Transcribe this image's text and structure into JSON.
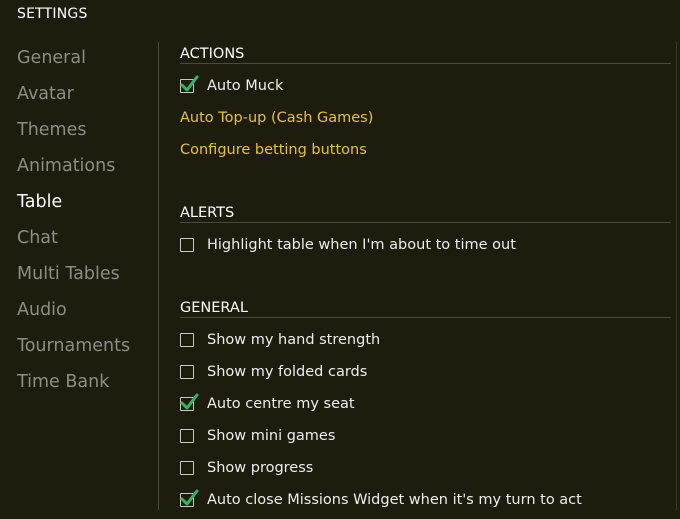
{
  "title": "SETTINGS",
  "sidebar": {
    "items": [
      {
        "label": "General"
      },
      {
        "label": "Avatar"
      },
      {
        "label": "Themes"
      },
      {
        "label": "Animations"
      },
      {
        "label": "Table",
        "active": true
      },
      {
        "label": "Chat"
      },
      {
        "label": "Multi Tables"
      },
      {
        "label": "Audio"
      },
      {
        "label": "Tournaments"
      },
      {
        "label": "Time Bank"
      }
    ]
  },
  "sections": {
    "actions": {
      "header": "ACTIONS",
      "auto_muck": {
        "label": "Auto Muck",
        "checked": true
      },
      "auto_topup_link": "Auto Top-up (Cash Games)",
      "betting_buttons_link": "Configure betting buttons"
    },
    "alerts": {
      "header": "ALERTS",
      "highlight_timeout": {
        "label": "Highlight table when I'm about to time out",
        "checked": false
      }
    },
    "general": {
      "header": "GENERAL",
      "options": [
        {
          "label": "Show my hand strength",
          "checked": false
        },
        {
          "label": "Show my folded cards",
          "checked": false
        },
        {
          "label": "Auto centre my seat",
          "checked": true
        },
        {
          "label": "Show mini games",
          "checked": false
        },
        {
          "label": "Show progress",
          "checked": false
        },
        {
          "label": "Auto close Missions Widget when it's my turn to act",
          "checked": true
        }
      ]
    }
  },
  "colors": {
    "background": "#1e1c0d",
    "link": "#e5c33a",
    "check": "#2fb56a",
    "inactive_nav": "#8f8d82"
  },
  "icons": {
    "check": "checkmark-icon"
  }
}
